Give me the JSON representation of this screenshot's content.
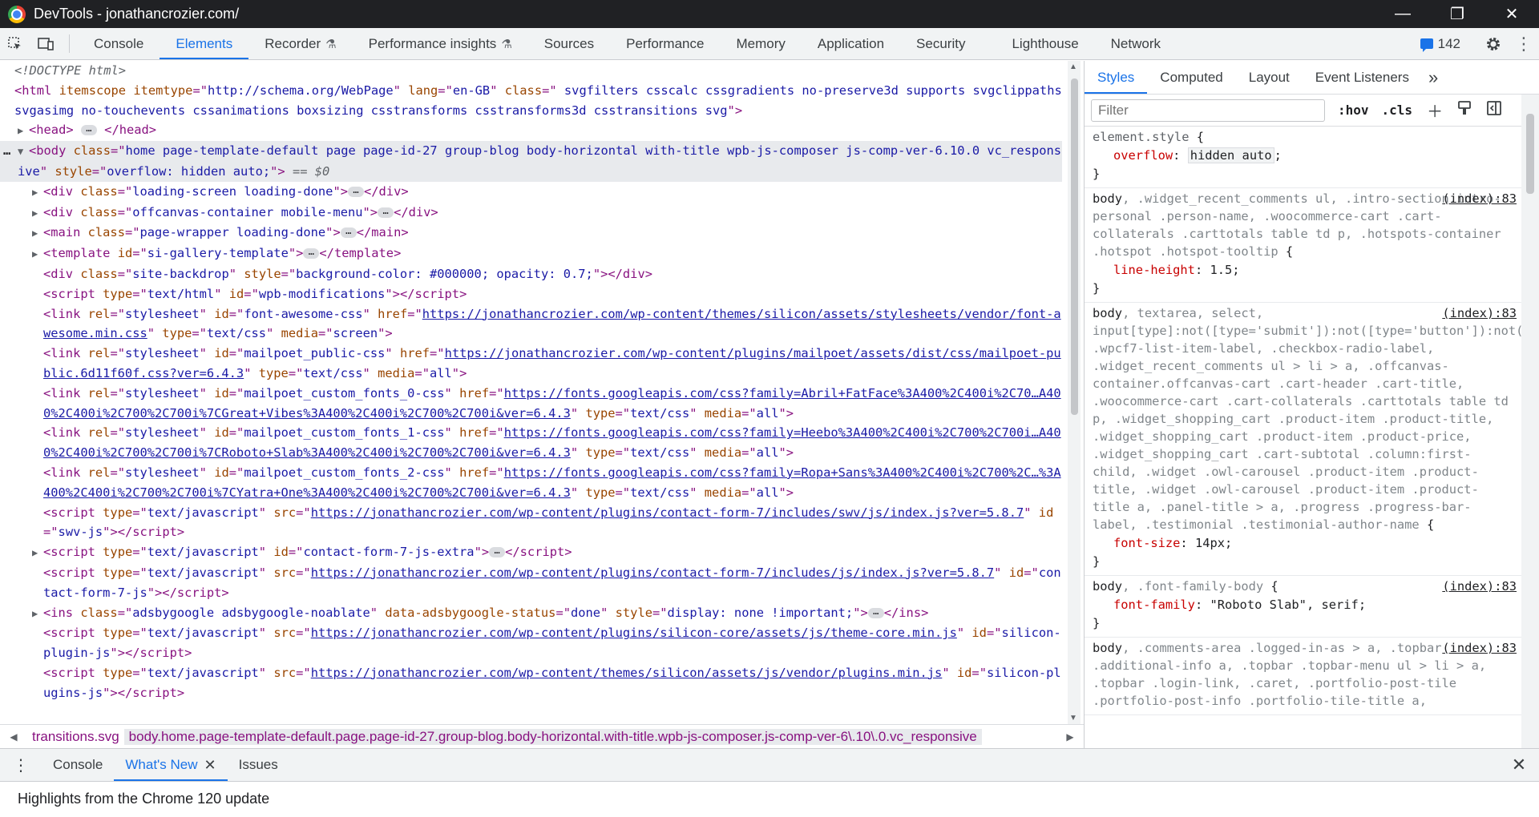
{
  "window": {
    "title": "DevTools - jonathancrozier.com/",
    "controls": [
      "—",
      "❐",
      "✕"
    ]
  },
  "toolbar": {
    "tabs": [
      {
        "label": "Console",
        "active": false,
        "flask": false
      },
      {
        "label": "Elements",
        "active": true,
        "flask": false
      },
      {
        "label": "Recorder",
        "active": false,
        "flask": true
      },
      {
        "label": "Performance insights",
        "active": false,
        "flask": true
      },
      {
        "label": "Sources",
        "active": false,
        "flask": false
      },
      {
        "label": "Performance",
        "active": false,
        "flask": false
      },
      {
        "label": "Memory",
        "active": false,
        "flask": false
      },
      {
        "label": "Application",
        "active": false,
        "flask": false
      },
      {
        "label": "Security",
        "active": false,
        "flask": false
      },
      {
        "label": "Lighthouse",
        "active": false,
        "flask": false
      },
      {
        "label": "Network",
        "active": false,
        "flask": false
      }
    ],
    "issues_count": "142"
  },
  "elements": {
    "doctype": "<!DOCTYPE html>",
    "html_line": {
      "tag": "html",
      "attrs": [
        [
          "itemscope",
          null
        ],
        [
          "itemtype",
          "http://schema.org/WebPage"
        ],
        [
          "lang",
          "en-GB"
        ],
        [
          "class",
          " svgfilters csscalc cssgradients no-preserve3d supports svgclippaths svgasimg no-touchevents cssanimations boxsizing csstransforms csstransforms3d csstransitions svg"
        ]
      ]
    },
    "head_tag": "head",
    "body_line": {
      "class": "home page-template-default page page-id-27 group-blog body-horizontal with-title wpb-js-composer js-comp-ver-6.10.0 vc_responsive",
      "style": "overflow: hidden auto;",
      "eq": "== $0"
    },
    "children": [
      {
        "collapsed": true,
        "tag": "div",
        "attrs": [
          [
            "class",
            "loading-screen loading-done"
          ]
        ],
        "ellipsis": true
      },
      {
        "collapsed": true,
        "tag": "div",
        "attrs": [
          [
            "class",
            "offcanvas-container mobile-menu"
          ]
        ],
        "ellipsis": true
      },
      {
        "collapsed": true,
        "tag": "main",
        "attrs": [
          [
            "class",
            "page-wrapper loading-done"
          ]
        ],
        "ellipsis": true
      },
      {
        "collapsed": true,
        "tag": "template",
        "attrs": [
          [
            "id",
            "si-gallery-template"
          ]
        ],
        "ellipsis": true
      },
      {
        "collapsed": false,
        "tag": "div",
        "attrs": [
          [
            "class",
            "site-backdrop"
          ],
          [
            "style",
            "background-color: #000000; opacity: 0.7;"
          ]
        ],
        "closeTag": true
      },
      {
        "collapsed": false,
        "tag": "script",
        "attrs": [
          [
            "type",
            "text/html"
          ],
          [
            "id",
            "wpb-modifications"
          ]
        ],
        "closeTag": true
      },
      {
        "collapsed": false,
        "tag": "link",
        "attrs": [
          [
            "rel",
            "stylesheet"
          ],
          [
            "id",
            "font-awesome-css"
          ],
          [
            "href",
            "https://jonathancrozier.com/wp-content/themes/silicon/assets/stylesheets/vendor/font-awesome.min.css",
            "link"
          ],
          [
            "type",
            "text/css"
          ],
          [
            "media",
            "screen"
          ]
        ]
      },
      {
        "collapsed": false,
        "tag": "link",
        "attrs": [
          [
            "rel",
            "stylesheet"
          ],
          [
            "id",
            "mailpoet_public-css"
          ],
          [
            "href",
            "https://jonathancrozier.com/wp-content/plugins/mailpoet/assets/dist/css/mailpoet-public.6d11f60f.css?ver=6.4.3",
            "link"
          ],
          [
            "type",
            "text/css"
          ],
          [
            "media",
            "all"
          ]
        ]
      },
      {
        "collapsed": false,
        "tag": "link",
        "attrs": [
          [
            "rel",
            "stylesheet"
          ],
          [
            "id",
            "mailpoet_custom_fonts_0-css"
          ],
          [
            "href",
            "https://fonts.googleapis.com/css?family=Abril+FatFace%3A400%2C400i%2C70…A400%2C400i%2C700%2C700i%7CGreat+Vibes%3A400%2C400i%2C700%2C700i&ver=6.4.3",
            "link"
          ],
          [
            "type",
            "text/css"
          ],
          [
            "media",
            "all"
          ]
        ]
      },
      {
        "collapsed": false,
        "tag": "link",
        "attrs": [
          [
            "rel",
            "stylesheet"
          ],
          [
            "id",
            "mailpoet_custom_fonts_1-css"
          ],
          [
            "href",
            "https://fonts.googleapis.com/css?family=Heebo%3A400%2C400i%2C700%2C700i…A400%2C400i%2C700%2C700i%7CRoboto+Slab%3A400%2C400i%2C700%2C700i&ver=6.4.3",
            "link"
          ],
          [
            "type",
            "text/css"
          ],
          [
            "media",
            "all"
          ]
        ]
      },
      {
        "collapsed": false,
        "tag": "link",
        "attrs": [
          [
            "rel",
            "stylesheet"
          ],
          [
            "id",
            "mailpoet_custom_fonts_2-css"
          ],
          [
            "href",
            "https://fonts.googleapis.com/css?family=Ropa+Sans%3A400%2C400i%2C700%2C…%3A400%2C400i%2C700%2C700i%7CYatra+One%3A400%2C400i%2C700%2C700i&ver=6.4.3",
            "link"
          ],
          [
            "type",
            "text/css"
          ],
          [
            "media",
            "all"
          ]
        ]
      },
      {
        "collapsed": false,
        "tag": "script",
        "attrs": [
          [
            "type",
            "text/javascript"
          ],
          [
            "src",
            "https://jonathancrozier.com/wp-content/plugins/contact-form-7/includes/swv/js/index.js?ver=5.8.7",
            "link"
          ],
          [
            "id",
            "swv-js"
          ]
        ],
        "closeTag": true
      },
      {
        "collapsed": true,
        "tag": "script",
        "attrs": [
          [
            "type",
            "text/javascript"
          ],
          [
            "id",
            "contact-form-7-js-extra"
          ]
        ],
        "ellipsis": true
      },
      {
        "collapsed": false,
        "tag": "script",
        "attrs": [
          [
            "type",
            "text/javascript"
          ],
          [
            "src",
            "https://jonathancrozier.com/wp-content/plugins/contact-form-7/includes/js/index.js?ver=5.8.7",
            "link"
          ],
          [
            "id",
            "contact-form-7-js"
          ]
        ],
        "closeTag": true
      },
      {
        "collapsed": true,
        "tag": "ins",
        "attrs": [
          [
            "class",
            "adsbygoogle adsbygoogle-noablate"
          ],
          [
            "data-adsbygoogle-status",
            "done"
          ],
          [
            "style",
            "display: none !important;"
          ]
        ],
        "ellipsis": true
      },
      {
        "collapsed": false,
        "tag": "script",
        "attrs": [
          [
            "type",
            "text/javascript"
          ],
          [
            "src",
            "https://jonathancrozier.com/wp-content/plugins/silicon-core/assets/js/theme-core.min.js",
            "link"
          ],
          [
            "id",
            "silicon-plugin-js"
          ]
        ],
        "closeTag": true
      },
      {
        "collapsed": false,
        "tag": "script",
        "attrs": [
          [
            "type",
            "text/javascript"
          ],
          [
            "src",
            "https://jonathancrozier.com/wp-content/themes/silicon/assets/js/vendor/plugins.min.js",
            "link"
          ],
          [
            "id",
            "silicon-plugins-js"
          ]
        ],
        "closeTag": true
      }
    ]
  },
  "breadcrumb": {
    "items": [
      "transitions.svg",
      "body.home.page-template-default.page.page-id-27.group-blog.body-horizontal.with-title.wpb-js-composer.js-comp-ver-6\\.10\\.0.vc_responsive"
    ]
  },
  "styles_pane": {
    "tabs": [
      "Styles",
      "Computed",
      "Layout",
      "Event Listeners"
    ],
    "more": "»",
    "filter_placeholder": "Filter",
    "hov": ":hov",
    "cls": ".cls",
    "rules": [
      {
        "selector_active": "element.style",
        "selector_inactive": "",
        "source": "",
        "decls": [
          [
            "overflow",
            "hidden auto",
            true
          ]
        ]
      },
      {
        "selector_active": "body",
        "selector_inactive": ", .widget_recent_comments ul, .intro-section.intro-personal .person-name, .woocommerce-cart .cart-collaterals .carttotals table td p, .hotspots-container .hotspot .hotspot-tooltip",
        "source": "(index):83",
        "decls": [
          [
            "line-height",
            "1.5",
            false
          ]
        ]
      },
      {
        "selector_active": "body",
        "selector_inactive": ", textarea, select, input[type]:not([type='submit']):not([type='button']):not([type='hidden']):not([type='checkbox']):not([type='radio']):not([type='file']), .wpcf7-list-item-label, .checkbox-radio-label, .widget_recent_comments ul > li > a, .offcanvas-container.offcanvas-cart .cart-header .cart-title, .woocommerce-cart .cart-collaterals .carttotals table td p, .widget_shopping_cart .product-item .product-title, .widget_shopping_cart .product-item .product-price, .widget_shopping_cart .cart-subtotal .column:first-child, .widget .owl-carousel .product-item .product-title, .widget .owl-carousel .product-item .product-title a, .panel-title > a, .progress .progress-bar-label, .testimonial .testimonial-author-name",
        "source": "(index):83",
        "decls": [
          [
            "font-size",
            "14px",
            false
          ]
        ]
      },
      {
        "selector_active": "body",
        "selector_inactive": ", .font-family-body",
        "source": "(index):83",
        "decls": [
          [
            "font-family",
            "\"Roboto Slab\", serif",
            false
          ]
        ]
      },
      {
        "selector_active": "body",
        "selector_inactive": ", .comments-area .logged-in-as > a, .topbar .additional-info a, .topbar .topbar-menu ul > li > a, .topbar .login-link, .caret, .portfolio-post-tile .portfolio-post-info .portfolio-tile-title a,",
        "source": "(index):83",
        "decls": []
      }
    ]
  },
  "drawer": {
    "tabs": [
      {
        "label": "Console",
        "active": false,
        "closable": false
      },
      {
        "label": "What's New",
        "active": true,
        "closable": true
      },
      {
        "label": "Issues",
        "active": false,
        "closable": false
      }
    ],
    "content": "Highlights from the Chrome 120 update"
  },
  "icons": [
    "chrome-logo-icon",
    "inspect-icon",
    "device-toolbar-icon",
    "flask-icon",
    "issues-icon",
    "settings-gear-icon",
    "more-vert-icon",
    "new-rule-icon",
    "paint-icon",
    "sidebar-toggle-icon",
    "close-icon"
  ]
}
